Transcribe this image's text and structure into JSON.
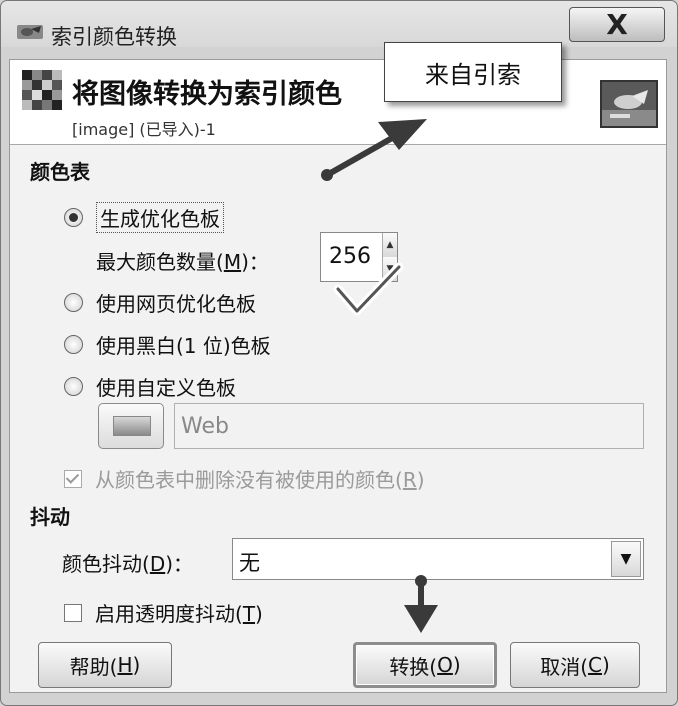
{
  "window": {
    "title": "索引颜色转换",
    "close_symbol": "X"
  },
  "header": {
    "title": "将图像转换为索引颜色",
    "subtitle": "[image] (已导入)-1"
  },
  "callout": {
    "text": "来自引索"
  },
  "colormap": {
    "section_title": "颜色表",
    "options": [
      {
        "label": "生成优化色板",
        "checked": true
      },
      {
        "label": "使用网页优化色板",
        "checked": false
      },
      {
        "label": "使用黑白(1 位)色板",
        "checked": false
      },
      {
        "label": "使用自定义色板",
        "checked": false
      }
    ],
    "max_colors": {
      "label_prefix": "最大颜色数量(",
      "mnemonic": "M",
      "label_suffix": ")：",
      "value": "256"
    },
    "custom_palette": {
      "value": "Web"
    },
    "remove_unused": {
      "label_prefix": "从颜色表中删除没有被使用的颜色(",
      "mnemonic": "R",
      "label_suffix": ")",
      "checked": true,
      "enabled": false
    }
  },
  "dithering": {
    "section_title": "抖动",
    "color_dither": {
      "label_prefix": "颜色抖动(",
      "mnemonic": "D",
      "label_suffix": ")：",
      "value": "无"
    },
    "transparency_dither": {
      "label_prefix": "启用透明度抖动(",
      "mnemonic": "T",
      "label_suffix": ")",
      "checked": false
    }
  },
  "buttons": {
    "help": {
      "prefix": "帮助(",
      "mnemonic": "H",
      "suffix": ")"
    },
    "convert": {
      "prefix": "转换(",
      "mnemonic": "O",
      "suffix": ")"
    },
    "cancel": {
      "prefix": "取消(",
      "mnemonic": "C",
      "suffix": ")"
    }
  },
  "icons": {
    "app": "gimp-icon",
    "header": "indexed-grid-icon",
    "thumbnail": "image-thumbnail",
    "spin_up": "spin-up-icon",
    "spin_down": "spin-down-icon",
    "dropdown": "dropdown-arrow-icon"
  },
  "colors": {
    "window_bg": "#d2d2d2",
    "client_bg": "#f2f2f2",
    "header_bg": "#ffffff",
    "annotation": "#3a3a3a"
  }
}
